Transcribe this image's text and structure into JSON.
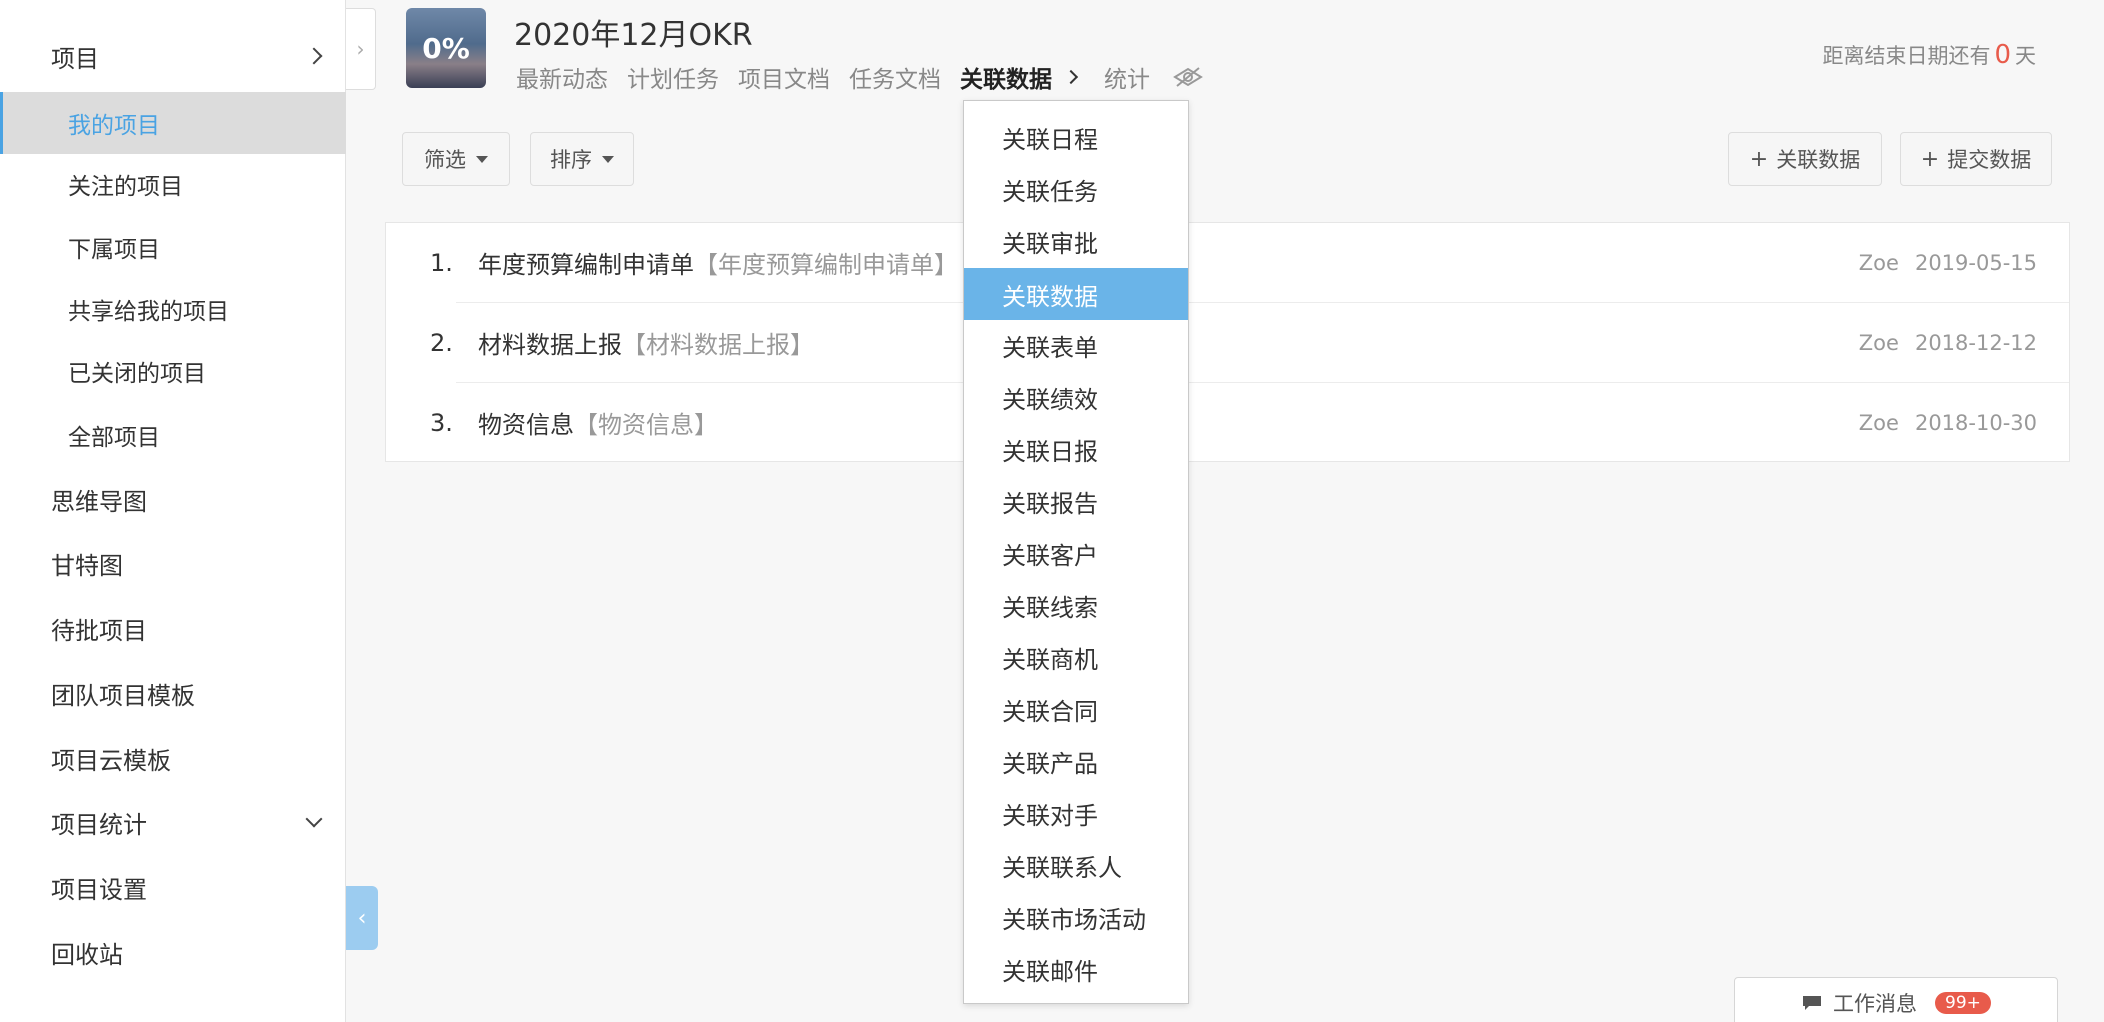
{
  "sidebar": {
    "items": [
      {
        "label": "项目",
        "type": "top",
        "chevron": "right"
      },
      {
        "label": "我的项目",
        "type": "sub",
        "active": true
      },
      {
        "label": "关注的项目",
        "type": "sub"
      },
      {
        "label": "下属项目",
        "type": "sub"
      },
      {
        "label": "共享给我的项目",
        "type": "sub"
      },
      {
        "label": "已关闭的项目",
        "type": "sub"
      },
      {
        "label": "全部项目",
        "type": "sub"
      },
      {
        "label": "思维导图",
        "type": "top"
      },
      {
        "label": "甘特图",
        "type": "top"
      },
      {
        "label": "待批项目",
        "type": "top"
      },
      {
        "label": "团队项目模板",
        "type": "top"
      },
      {
        "label": "项目云模板",
        "type": "top"
      },
      {
        "label": "项目统计",
        "type": "top",
        "chevron": "down"
      },
      {
        "label": "项目设置",
        "type": "top"
      },
      {
        "label": "回收站",
        "type": "top"
      }
    ]
  },
  "header": {
    "progress": "0%",
    "title": "2020年12月OKR",
    "tabs": [
      "最新动态",
      "计划任务",
      "项目文档",
      "任务文档",
      "关联数据",
      "统计"
    ],
    "active_tab": "关联数据",
    "deadline": {
      "prefix": "距离结束日期还有",
      "days": "0",
      "suffix": "天"
    }
  },
  "toolbar": {
    "filter_label": "筛选",
    "sort_label": "排序",
    "link_data_label": "关联数据",
    "submit_data_label": "提交数据"
  },
  "list": {
    "rows": [
      {
        "index": "1.",
        "name": "年度预算编制申请单",
        "alias": "【年度预算编制申请单】",
        "user": "Zoe",
        "date": "2019-05-15"
      },
      {
        "index": "2.",
        "name": "材料数据上报",
        "alias": "【材料数据上报】",
        "user": "Zoe",
        "date": "2018-12-12"
      },
      {
        "index": "3.",
        "name": "物资信息",
        "alias": "【物资信息】",
        "user": "Zoe",
        "date": "2018-10-30"
      }
    ]
  },
  "dropdown": {
    "selected": "关联数据",
    "items": [
      "关联日程",
      "关联任务",
      "关联审批",
      "关联数据",
      "关联表单",
      "关联绩效",
      "关联日报",
      "关联报告",
      "关联客户",
      "关联线索",
      "关联商机",
      "关联合同",
      "关联产品",
      "关联对手",
      "关联联系人",
      "关联市场活动",
      "关联邮件"
    ]
  },
  "work_message": {
    "label": "工作消息",
    "badge": "99+"
  },
  "colors": {
    "accent": "#4aa3e3",
    "selected_bg": "#6ab4e8",
    "alert": "#e85b4b"
  }
}
